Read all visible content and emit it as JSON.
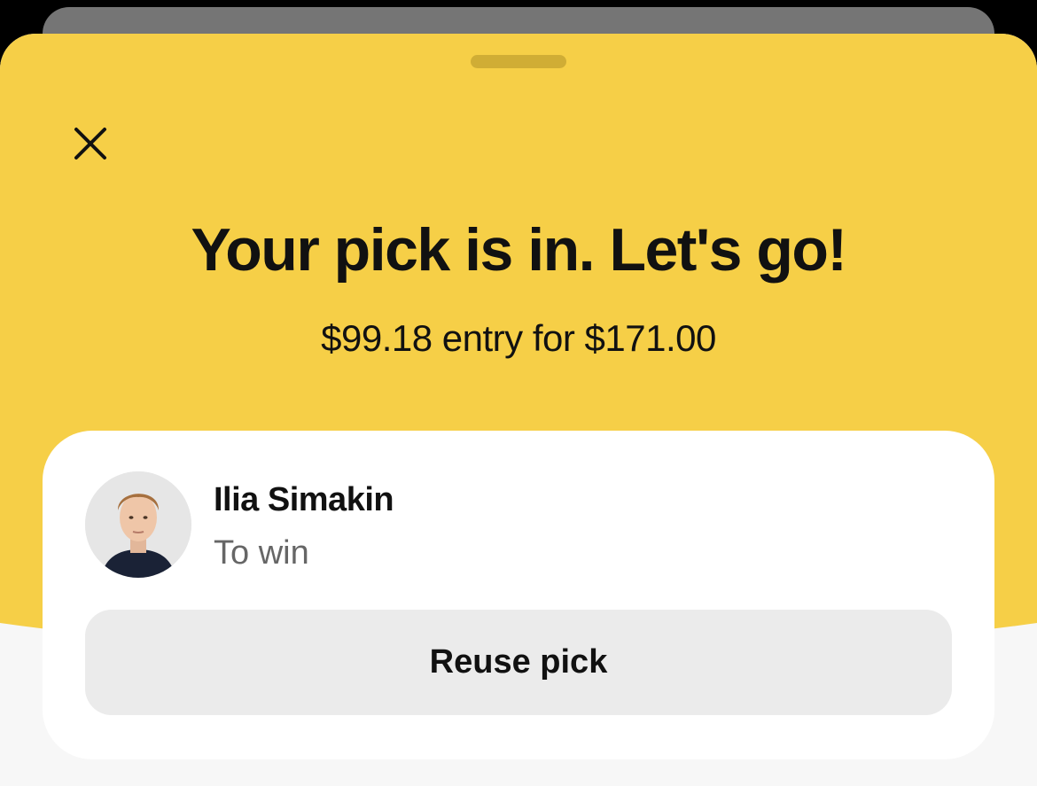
{
  "sheet": {
    "close_icon": "close-icon",
    "headline": "Your pick is in. Let's go!",
    "subline": "$99.18 entry for $171.00"
  },
  "pick_card": {
    "avatar_icon": "player-avatar",
    "player_name": "Ilia Simakin",
    "bet_type": "To win",
    "reuse_button_label": "Reuse pick"
  },
  "colors": {
    "accent_yellow": "#f6cf47",
    "card_white": "#ffffff",
    "button_gray": "#ebebeb",
    "text_dark": "#111111",
    "text_muted": "#666666"
  }
}
